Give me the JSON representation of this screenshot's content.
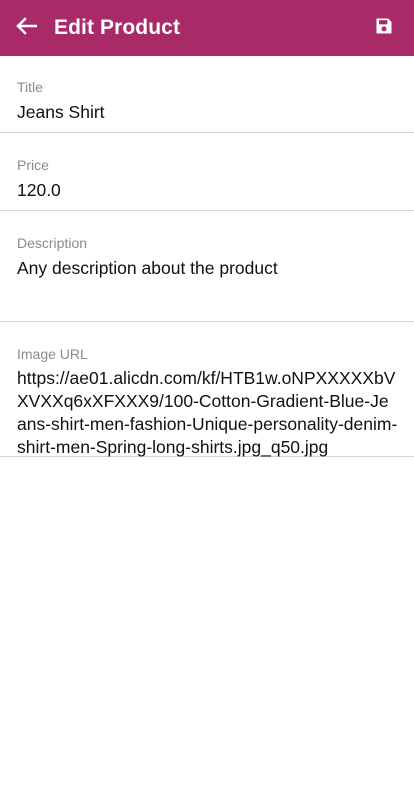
{
  "app_bar": {
    "title": "Edit Product",
    "back_icon": "arrow-left-icon",
    "save_icon": "save-icon",
    "background": "#a82a67"
  },
  "form": {
    "title": {
      "label": "Title",
      "value": "Jeans Shirt"
    },
    "price": {
      "label": "Price",
      "value": "120.0"
    },
    "description": {
      "label": "Description",
      "value": "Any description about the product"
    },
    "image_url": {
      "label": "Image URL",
      "value": "https://ae01.alicdn.com/kf/HTB1w.oNPXXXXXbVXVXXq6xXFXXX9/100-Cotton-Gradient-Blue-Jeans-shirt-men-fashion-Unique-personality-denim-shirt-men-Spring-long-shirts.jpg_q50.jpg"
    }
  }
}
